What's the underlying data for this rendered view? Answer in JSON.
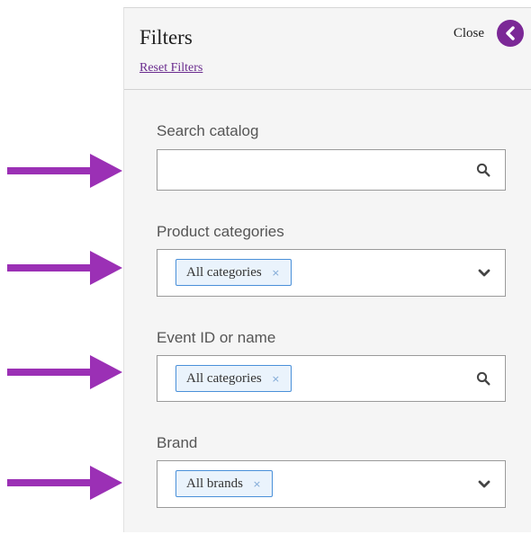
{
  "filters": {
    "title": "Filters",
    "reset_label": "Reset Filters",
    "close_label": "Close"
  },
  "fields": {
    "search": {
      "label": "Search catalog",
      "value": ""
    },
    "categories": {
      "label": "Product categories",
      "tag": "All categories",
      "tag_remove": "×"
    },
    "event": {
      "label": "Event ID or name",
      "tag": "All categories",
      "tag_remove": "×"
    },
    "brand": {
      "label": "Brand",
      "tag": "All brands",
      "tag_remove": "×"
    }
  },
  "colors": {
    "accent": "#7b2896",
    "arrow": "#9b30b5",
    "tag_border": "#4a90d9"
  }
}
